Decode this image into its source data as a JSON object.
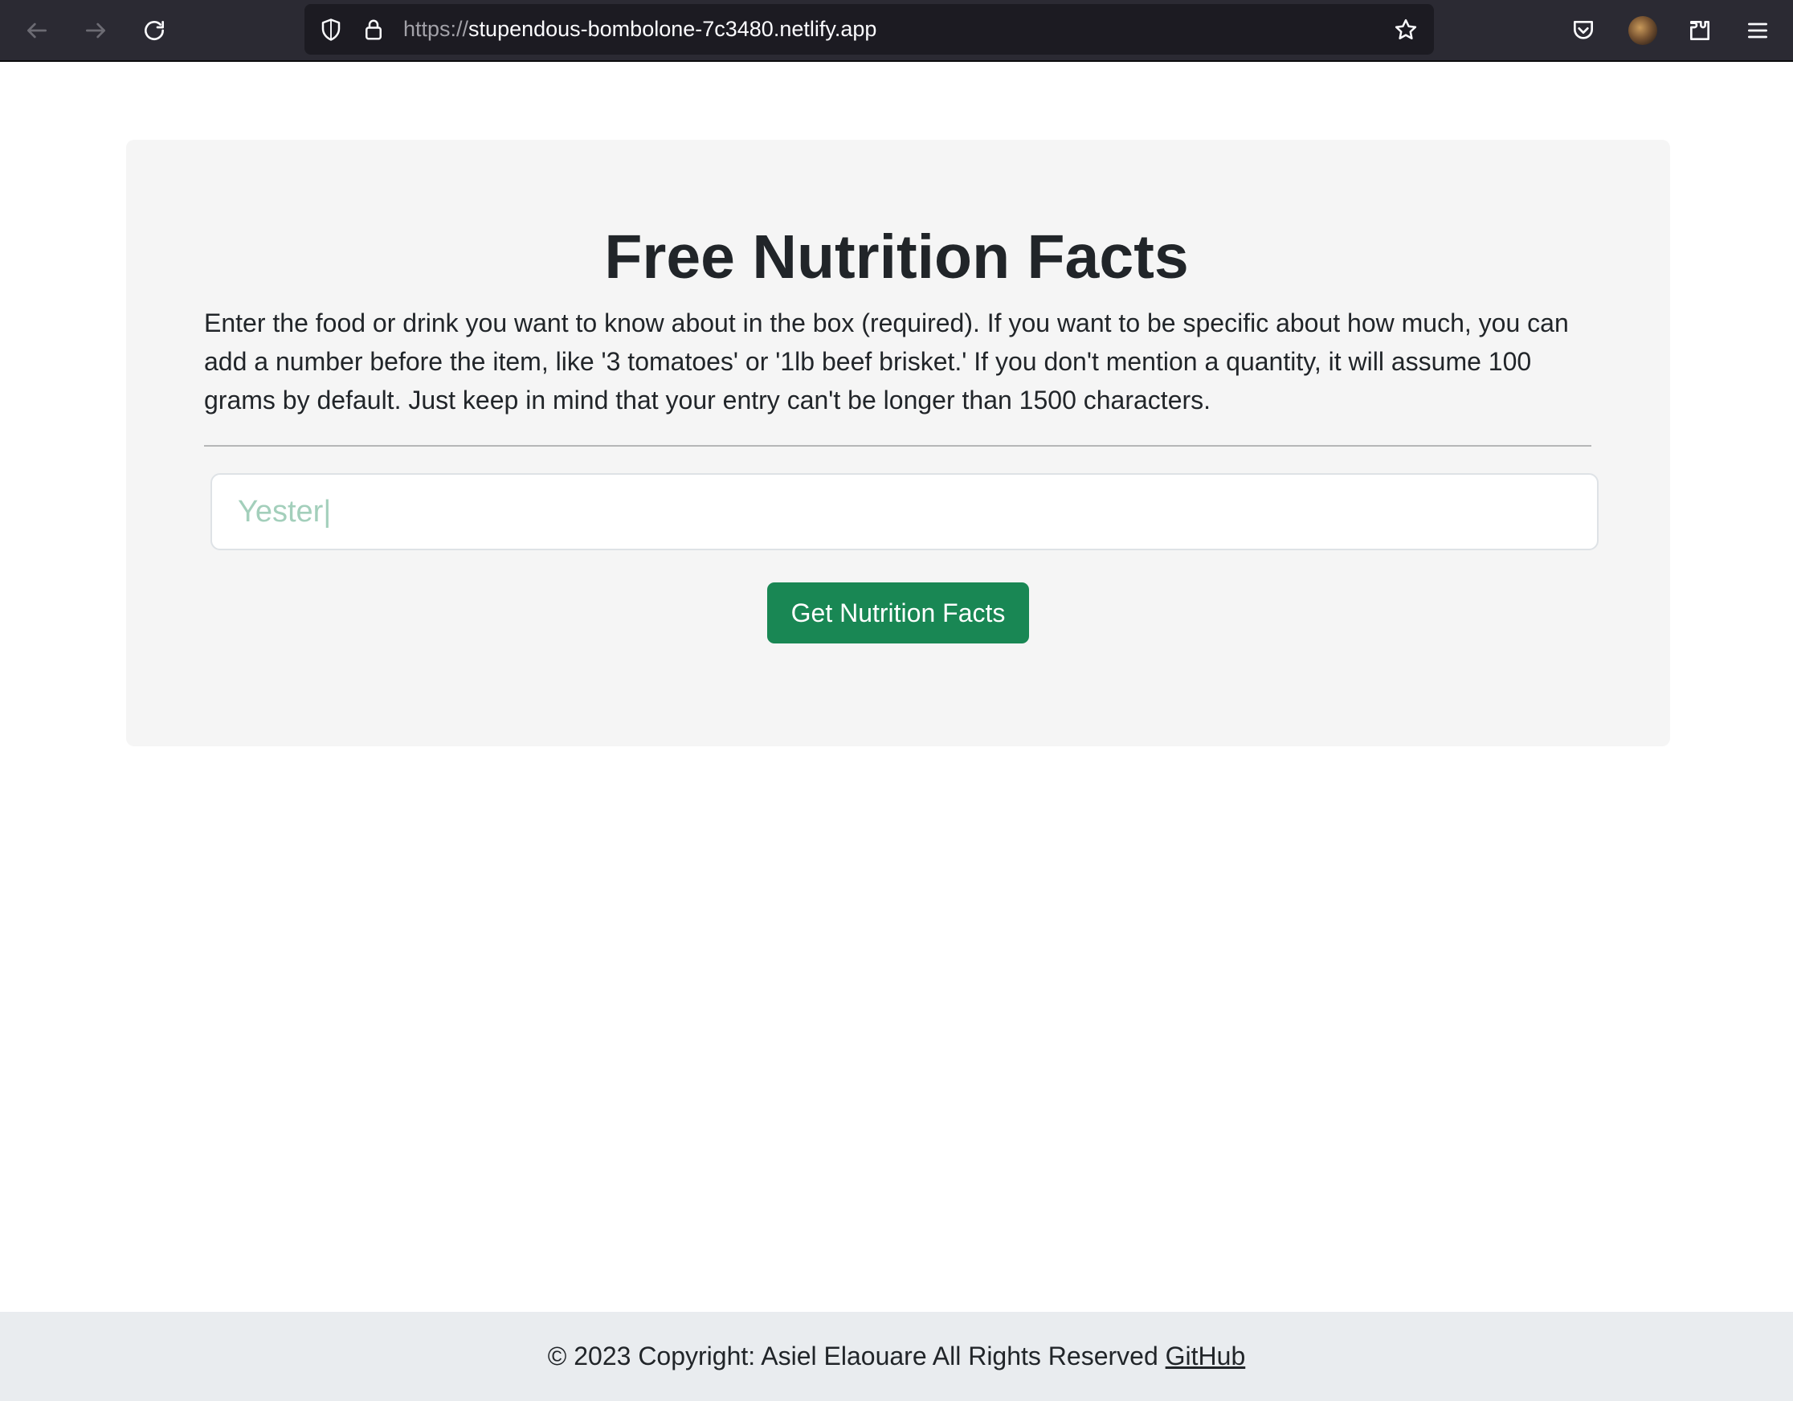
{
  "browser": {
    "url_scheme": "https://",
    "url_host": "stupendous-bombolone-7c3480.netlify.app",
    "icons": [
      "back-arrow-icon",
      "forward-arrow-icon",
      "reload-icon",
      "shield-icon",
      "lock-icon",
      "star-icon",
      "pocket-icon",
      "account-avatar",
      "extensions-icon",
      "hamburger-menu-icon"
    ]
  },
  "main": {
    "title": "Free Nutrition Facts",
    "intro": "Enter the food or drink you want to know about in the box (required). If you want to be specific about how much, you can add a number before the item, like '3 tomatoes' or '1lb beef brisket.' If you don't mention a quantity, it will assume 100 grams by default. Just keep in mind that your entry can't be longer than 1500 characters.",
    "input_placeholder": "Yester|",
    "button_label": "Get Nutrition Facts"
  },
  "footer": {
    "copyright": "© 2023 Copyright: Asiel Elaouare All Rights Reserved",
    "link_label": "GitHub"
  },
  "colors": {
    "button": "#198754",
    "placeholder": "#a3cfbb",
    "panel": "#f5f5f5",
    "footer": "#e9ecef",
    "browser_chrome": "#2b2a33"
  }
}
